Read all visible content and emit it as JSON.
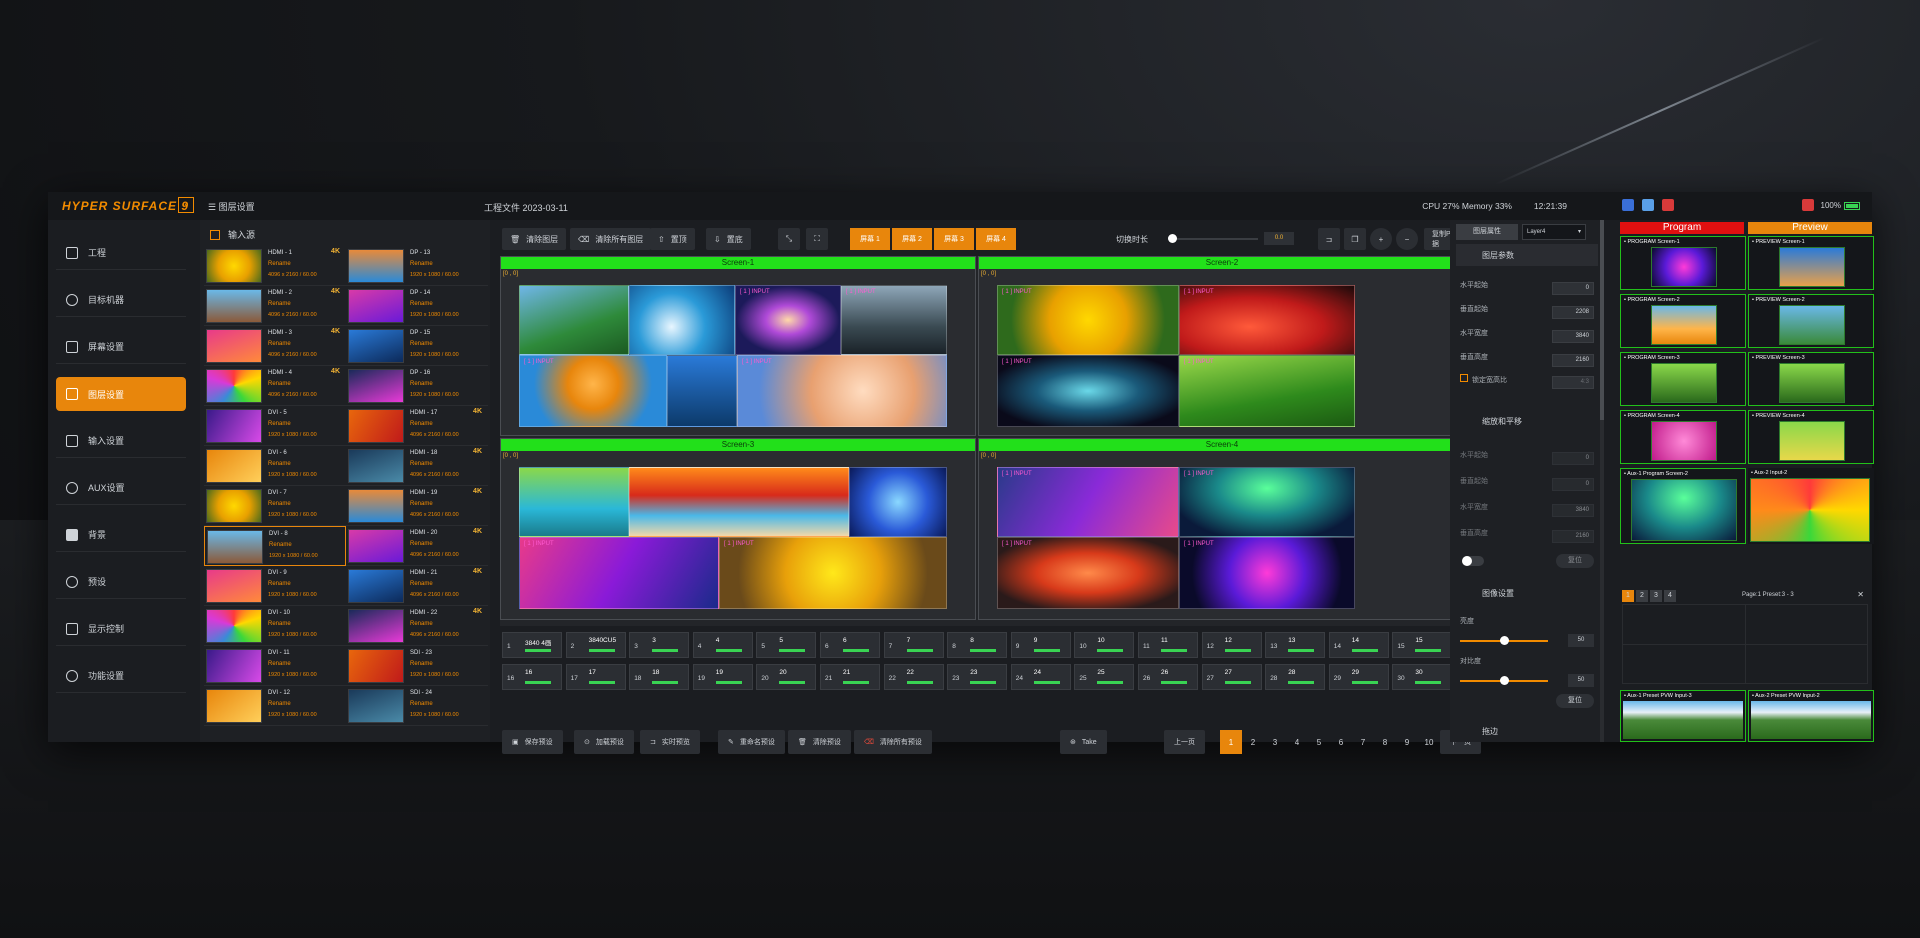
{
  "app": {
    "logo": "HYPER SURFACE 9",
    "menu_label": "图层设置",
    "project_file": "工程文件 2023-03-11",
    "stats": "CPU 27% Memory 33%",
    "clock": "12:21:39",
    "battery": "100%"
  },
  "sidebar": {
    "items": [
      {
        "label": "工程"
      },
      {
        "label": "目标机器"
      },
      {
        "label": "屏幕设置"
      },
      {
        "label": "图层设置",
        "active": true
      },
      {
        "label": "输入设置"
      },
      {
        "label": "AUX设置"
      },
      {
        "label": "背景"
      },
      {
        "label": "预设"
      },
      {
        "label": "显示控制"
      },
      {
        "label": "功能设置"
      }
    ]
  },
  "inputs": {
    "header": "输入源",
    "rename": "Rename",
    "badge": "4K",
    "sources": [
      {
        "name": "HDMI - 1",
        "res": "4096 x 2160 / 60.00"
      },
      {
        "name": "DP - 13",
        "res": "1920 x 1080 / 60.00"
      },
      {
        "name": "HDMI - 2",
        "res": "4096 x 2160 / 60.00"
      },
      {
        "name": "DP - 14",
        "res": "1920 x 1080 / 60.00"
      },
      {
        "name": "HDMI - 3",
        "res": "4096 x 2160 / 60.00"
      },
      {
        "name": "DP - 15",
        "res": "1920 x 1080 / 60.00"
      },
      {
        "name": "HDMI - 4",
        "res": "4096 x 2160 / 60.00"
      },
      {
        "name": "DP - 16",
        "res": "1920 x 1080 / 60.00"
      },
      {
        "name": "DVI - 5",
        "res": "1920 x 1080 / 60.00"
      },
      {
        "name": "HDMI - 17",
        "res": "4096 x 2160 / 60.00"
      },
      {
        "name": "DVI - 6",
        "res": "1920 x 1080 / 60.00"
      },
      {
        "name": "HDMI - 18",
        "res": "4096 x 2160 / 60.00"
      },
      {
        "name": "DVI - 7",
        "res": "1920 x 1080 / 60.00"
      },
      {
        "name": "HDMI - 19",
        "res": "4096 x 2160 / 60.00"
      },
      {
        "name": "DVI - 8",
        "res": "1920 x 1080 / 60.00"
      },
      {
        "name": "HDMI - 20",
        "res": "4096 x 2160 / 60.00"
      },
      {
        "name": "DVI - 9",
        "res": "1920 x 1080 / 60.00"
      },
      {
        "name": "HDMI - 21",
        "res": "4096 x 2160 / 60.00"
      },
      {
        "name": "DVI - 10",
        "res": "1920 x 1080 / 60.00"
      },
      {
        "name": "HDMI - 22",
        "res": "4096 x 2160 / 60.00"
      },
      {
        "name": "DVI - 11",
        "res": "1920 x 1080 / 60.00"
      },
      {
        "name": "SDI - 23",
        "res": "1920 x 1080 / 60.00"
      },
      {
        "name": "DVI - 12",
        "res": "1920 x 1080 / 60.00"
      },
      {
        "name": "SDI - 24",
        "res": "1920 x 1080 / 60.00"
      }
    ]
  },
  "toolbar": {
    "clear_layer": "清除图层",
    "clear_all_layers": "清除所有图层",
    "top": "置顶",
    "bottom": "置底",
    "screens": [
      "屏幕 1",
      "屏幕 2",
      "屏幕 3",
      "屏幕 4"
    ],
    "switch_duration_label": "切换时长",
    "duration": "0.0",
    "copy_program": "复制Program数据"
  },
  "screens": [
    {
      "name": "Screen-1",
      "coord": "[0 , 0]"
    },
    {
      "name": "Screen-2",
      "coord": "[0 , 0]"
    },
    {
      "name": "Screen-3",
      "coord": "[0 , 0]"
    },
    {
      "name": "Screen-4",
      "coord": "[0 , 0]"
    }
  ],
  "layer_label": "[ 1 ]  INPUT",
  "presets": [
    {
      "n": "1",
      "t": "3840 4画"
    },
    {
      "n": "2",
      "t": "3840CU5"
    },
    {
      "n": "3",
      "t": "3"
    },
    {
      "n": "4",
      "t": "4"
    },
    {
      "n": "5",
      "t": "5"
    },
    {
      "n": "6",
      "t": "6"
    },
    {
      "n": "7",
      "t": "7"
    },
    {
      "n": "8",
      "t": "8"
    },
    {
      "n": "9",
      "t": "9"
    },
    {
      "n": "10",
      "t": "10"
    },
    {
      "n": "11",
      "t": "11"
    },
    {
      "n": "12",
      "t": "12"
    },
    {
      "n": "13",
      "t": "13"
    },
    {
      "n": "14",
      "t": "14"
    },
    {
      "n": "15",
      "t": "15"
    },
    {
      "n": "16",
      "t": "16"
    },
    {
      "n": "17",
      "t": "17"
    },
    {
      "n": "18",
      "t": "18"
    },
    {
      "n": "19",
      "t": "19"
    },
    {
      "n": "20",
      "t": "20"
    },
    {
      "n": "21",
      "t": "21"
    },
    {
      "n": "22",
      "t": "22"
    },
    {
      "n": "23",
      "t": "23"
    },
    {
      "n": "24",
      "t": "24"
    },
    {
      "n": "25",
      "t": "25"
    },
    {
      "n": "26",
      "t": "26"
    },
    {
      "n": "27",
      "t": "27"
    },
    {
      "n": "28",
      "t": "28"
    },
    {
      "n": "29",
      "t": "29"
    },
    {
      "n": "30",
      "t": "30"
    }
  ],
  "bottom": {
    "save_preset": "保存预设",
    "load_preset": "加载预设",
    "realtime_preview": "实时预览",
    "rename_preset": "重命名预设",
    "clear_preset": "清除预设",
    "clear_all_presets": "清除所有预设",
    "take": "Take",
    "prev": "上一页",
    "next": "下一页",
    "pages": [
      "1",
      "2",
      "3",
      "4",
      "5",
      "6",
      "7",
      "8",
      "9",
      "10"
    ]
  },
  "props": {
    "title": "图层属性",
    "layer_select": "Layer4",
    "params": "图层参数",
    "h_start": "水平起始",
    "v_start": "垂直起始",
    "h_width": "水平宽度",
    "v_height": "垂直高度",
    "vals": [
      "0",
      "2208",
      "3840",
      "2160"
    ],
    "lock_ratio": "锁定宽高比",
    "lock_val": "4:3",
    "zoom_pan": "缩放和平移",
    "zvals": [
      "0",
      "0",
      "3840",
      "2160"
    ],
    "reset": "复位",
    "image_settings": "图像设置",
    "brightness": "亮度",
    "brightness_val": "50",
    "contrast": "对比度",
    "contrast_val": "50",
    "edge": "拖边"
  },
  "monitors": {
    "program": "Program",
    "preview": "Preview",
    "left": [
      "• PROGRAM Screen-1",
      "• PROGRAM Screen-2",
      "• PROGRAM Screen-3",
      "• PROGRAM Screen-4",
      "• Aux-1   Program Screen-2"
    ],
    "right": [
      "• PREVIEW Screen-1",
      "• PREVIEW Screen-2",
      "• PREVIEW Screen-3",
      "• PREVIEW Screen-4",
      "• Aux-2   Input-2"
    ],
    "aux_tabs": [
      "1",
      "2",
      "3",
      "4"
    ],
    "aux_page": "Page:1    Preset:3 - 3",
    "aux_bottom": [
      "• Aux-1 Preset PVW  Input-3",
      "• Aux-2 Preset PVW  Input-2"
    ]
  },
  "colors": {
    "accent": "#e8860c",
    "green": "#22e01a",
    "program_red": "#e01010"
  }
}
